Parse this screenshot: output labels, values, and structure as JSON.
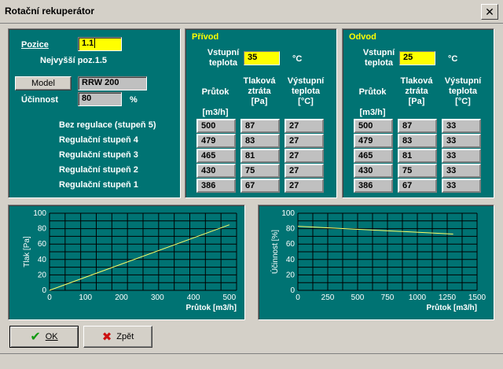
{
  "window": {
    "title": "Rotační rekuperátor",
    "close_glyph": "✕"
  },
  "left": {
    "pozice_label": "Pozice",
    "pozice_value": "1.1",
    "max_pos": "Nejvyšší poz.1.5",
    "model_button": "Model",
    "model_value": "RRW 200",
    "ucinnost_label": "Účinnost",
    "ucinnost_value": "80",
    "ucinnost_unit": "%",
    "row_labels": [
      "Bez regulace (stupeň 5)",
      "Regulační stupeň 4",
      "Regulační stupeň 3",
      "Regulační stupeň 2",
      "Regulační stupeň 1"
    ]
  },
  "prívod": {
    "title": "Přívod",
    "inlet_label_1": "Vstupní",
    "inlet_label_2": "teplota",
    "inlet_value": "35",
    "inlet_unit": "°C",
    "col1_a": "Průtok",
    "col1_b": "[m3/h]",
    "col2_a": "Tlaková",
    "col2_b": "ztráta",
    "col2_c": "[Pa]",
    "col3_a": "Výstupní",
    "col3_b": "teplota",
    "col3_c": "[°C]",
    "rows": [
      {
        "flow": "500",
        "loss": "87",
        "temp": "27"
      },
      {
        "flow": "479",
        "loss": "83",
        "temp": "27"
      },
      {
        "flow": "465",
        "loss": "81",
        "temp": "27"
      },
      {
        "flow": "430",
        "loss": "75",
        "temp": "27"
      },
      {
        "flow": "386",
        "loss": "67",
        "temp": "27"
      }
    ]
  },
  "odvod": {
    "title": "Odvod",
    "inlet_label_1": "Vstupní",
    "inlet_label_2": "teplota",
    "inlet_value": "25",
    "inlet_unit": "°C",
    "col1_a": "Průtok",
    "col1_b": "[m3/h]",
    "col2_a": "Tlaková",
    "col2_b": "ztráta",
    "col2_c": "[Pa]",
    "col3_a": "Výstupní",
    "col3_b": "teplota",
    "col3_c": "[°C]",
    "rows": [
      {
        "flow": "500",
        "loss": "87",
        "temp": "33"
      },
      {
        "flow": "479",
        "loss": "83",
        "temp": "33"
      },
      {
        "flow": "465",
        "loss": "81",
        "temp": "33"
      },
      {
        "flow": "430",
        "loss": "75",
        "temp": "33"
      },
      {
        "flow": "386",
        "loss": "67",
        "temp": "33"
      }
    ]
  },
  "buttons": {
    "ok": "OK",
    "back": "Zpět"
  },
  "colors": {
    "panel": "#007373",
    "line": "#ffff66",
    "highlight": "#ffff00"
  },
  "chart_data": [
    {
      "type": "line",
      "ylabel": "Tlak [Pa]",
      "xlabel": "Průtok [m3/h]",
      "xlim": [
        0,
        520
      ],
      "ylim": [
        0,
        100
      ],
      "xticks": [
        0,
        100,
        200,
        300,
        400,
        500
      ],
      "yticks": [
        0,
        20,
        40,
        60,
        80,
        100
      ],
      "grid": true,
      "series": [
        {
          "x": [
            0,
            500
          ],
          "y": [
            0,
            85
          ]
        }
      ]
    },
    {
      "type": "line",
      "ylabel": "Účinnost [%]",
      "xlabel": "Průtok [m3/h]",
      "xlim": [
        0,
        1500
      ],
      "ylim": [
        0,
        100
      ],
      "xticks": [
        0,
        250,
        500,
        750,
        1000,
        1250,
        1500
      ],
      "yticks": [
        0,
        20,
        40,
        60,
        80,
        100
      ],
      "grid": true,
      "series": [
        {
          "x": [
            0,
            1300
          ],
          "y": [
            83,
            73
          ]
        }
      ]
    }
  ]
}
